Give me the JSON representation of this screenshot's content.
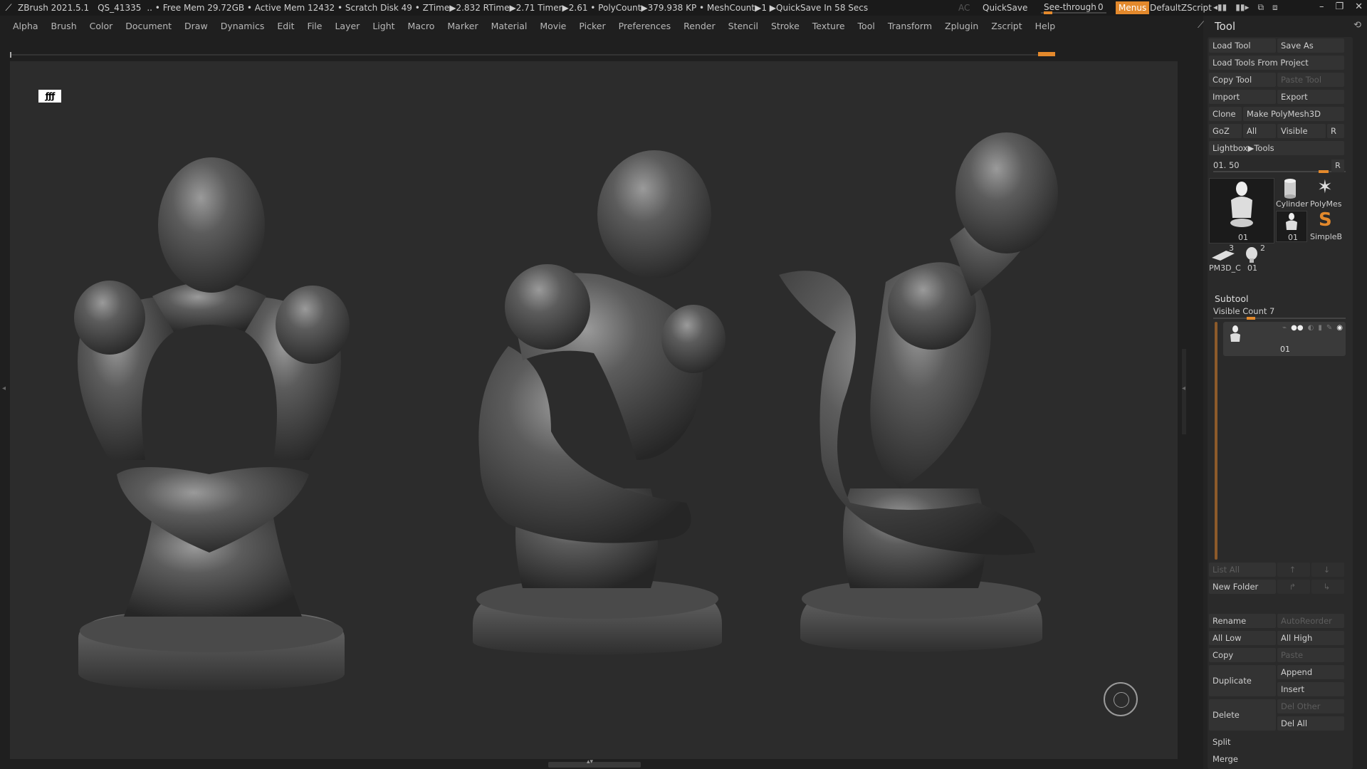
{
  "titlebar": {
    "app": "ZBrush 2021.5.1",
    "project": "QS_41335",
    "stats": ".. • Free Mem 29.72GB • Active Mem 12432 • Scratch Disk 49 • ZTime▶2.832 RTime▶2.71 Timer▶2.61 • PolyCount▶379.938 KP • MeshCount▶1 ▶QuickSave In 58 Secs",
    "ac": "AC",
    "quicksave": "QuickSave",
    "see_through_label": "See-through",
    "see_through_value": "0",
    "see_through_level": 0.05,
    "menus": "Menus",
    "default_zscript": "DefaultZScript"
  },
  "menubar": [
    "Alpha",
    "Brush",
    "Color",
    "Document",
    "Draw",
    "Dynamics",
    "Edit",
    "File",
    "Layer",
    "Light",
    "Macro",
    "Marker",
    "Material",
    "Movie",
    "Picker",
    "Preferences",
    "Render",
    "Stencil",
    "Stroke",
    "Texture",
    "Tool",
    "Transform",
    "Zplugin",
    "Zscript",
    "Help"
  ],
  "viewport": {
    "corner_badge": "ƒƒƒ",
    "accent": "#e3892c"
  },
  "tool_panel": {
    "title": "Tool",
    "load_tool": "Load Tool",
    "save_as": "Save As",
    "load_from_project": "Load Tools From Project",
    "copy_tool": "Copy Tool",
    "paste_tool": "Paste Tool",
    "import": "Import",
    "export": "Export",
    "clone": "Clone",
    "make_polymesh": "Make PolyMesh3D",
    "goz": "GoZ",
    "all": "All",
    "visible": "Visible",
    "r": "R",
    "lightbox_tools": "Lightbox▶Tools",
    "tool_slider_value": "01. 50",
    "tool_slider_level": 0.86,
    "thumbs": {
      "main": "01",
      "cylinder": "Cylinder",
      "polymesh": "PolyMes",
      "small_fig": "01",
      "simpleb": "SimpleB",
      "pm3d": "PM3D_C",
      "pm3d_count": "3",
      "head": "01",
      "head_count": "2"
    }
  },
  "subtool": {
    "title": "Subtool",
    "visible_count": "Visible Count 7",
    "visible_count_level": 0.27,
    "item_name": "01",
    "list_all": "List All",
    "new_folder": "New Folder",
    "rename": "Rename",
    "auto_reorder": "AutoReorder",
    "all_low": "All Low",
    "all_high": "All High",
    "copy": "Copy",
    "paste": "Paste",
    "duplicate": "Duplicate",
    "append": "Append",
    "insert": "Insert",
    "delete": "Delete",
    "del_other": "Del Other",
    "del_all": "Del All",
    "split": "Split",
    "merge": "Merge"
  }
}
